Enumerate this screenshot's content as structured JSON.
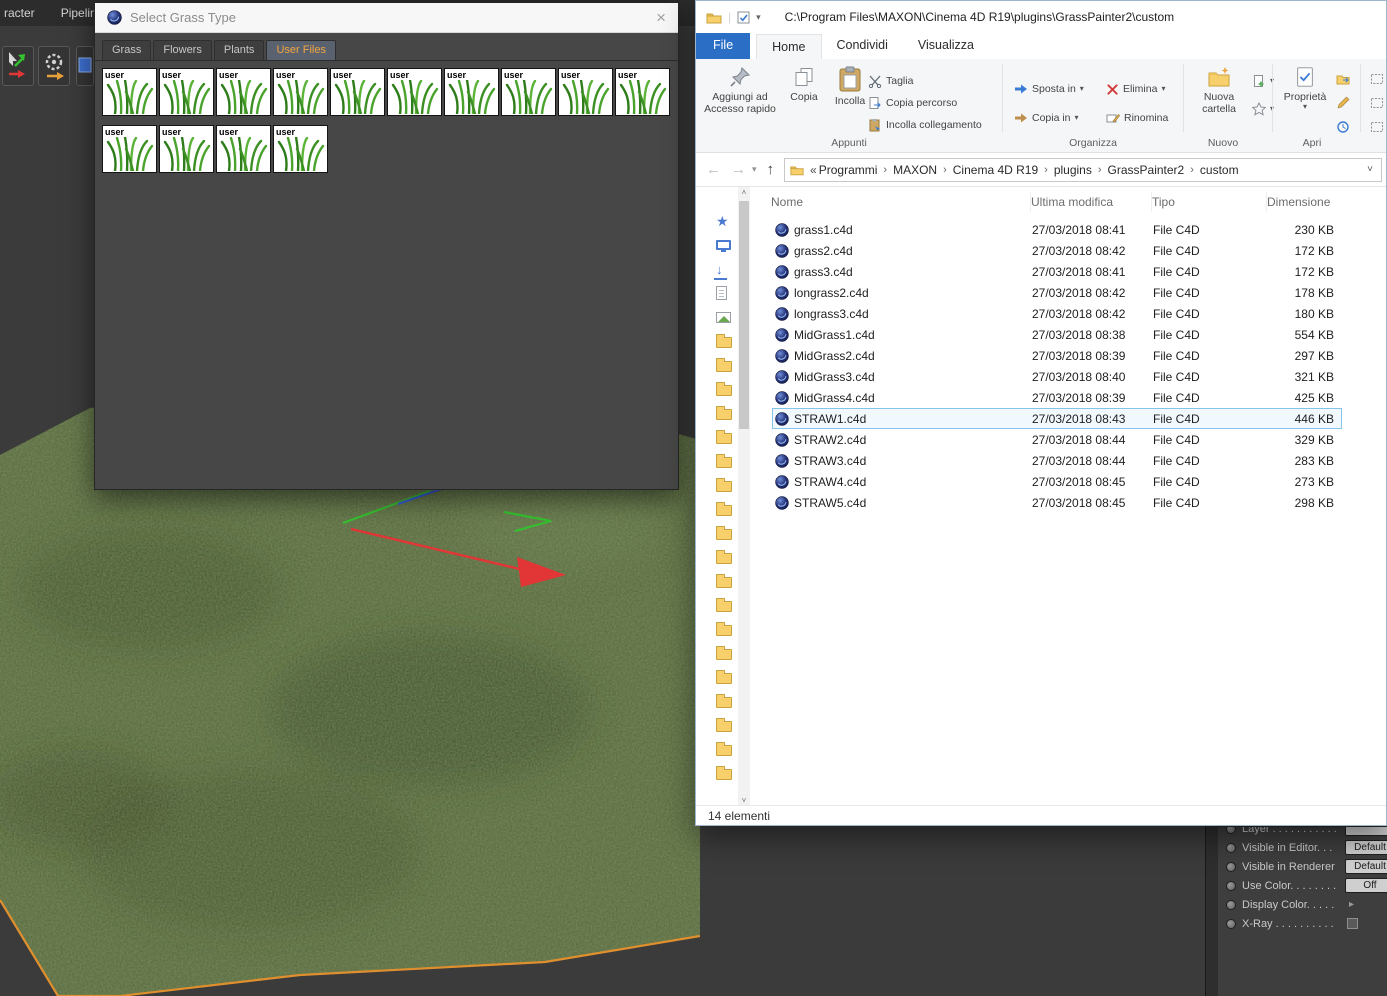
{
  "ui": {
    "dropdown": "▾",
    "breadcrumb_sep": "›",
    "back": "←",
    "forward": "→",
    "up": "↑",
    "address_chevron": "˅",
    "close": "×",
    "scroll_up": "˄",
    "scroll_down": "˅",
    "attr_arrow": "▸"
  },
  "colors": {
    "c4d_bg": "#3b3b3b",
    "menu_bg": "#2c2c2c",
    "dialog_bg": "#474747",
    "tab_active_text": "#f2a640",
    "file_tab": "#2b6ec6",
    "sel_border": "#84c3ea",
    "folder": "#f7d06b",
    "outline_orange": "#df8f2e",
    "axis_red": "#e23636",
    "axis_green": "#35c22f",
    "axis_blue": "#3b5bd7"
  },
  "c4d": {
    "menu": {
      "items": [
        {
          "label": "racter"
        },
        {
          "label": "Pipeline"
        }
      ]
    },
    "dialog": {
      "title": "Select Grass Type",
      "tabs": [
        {
          "label": "Grass"
        },
        {
          "label": "Flowers"
        },
        {
          "label": "Plants"
        },
        {
          "label": "User Files",
          "active": true
        }
      ],
      "thumbnails": [
        "user",
        "user",
        "user",
        "user",
        "user",
        "user",
        "user",
        "user",
        "user",
        "user",
        "user",
        "user",
        "user",
        "user"
      ]
    },
    "attributes": {
      "rows": [
        {
          "label": "Layer . . . . . . . . . . .",
          "control": "button",
          "value": ""
        },
        {
          "label": "Visible in Editor. . .",
          "control": "button",
          "value": "Default"
        },
        {
          "label": "Visible in Renderer",
          "control": "button",
          "value": "Default"
        },
        {
          "label": "Use Color. . . . . . . .",
          "control": "button",
          "value": "Off"
        },
        {
          "label": "Display Color. . . . .",
          "control": "arrow",
          "value": ""
        },
        {
          "label": "X-Ray . . . . . . . . . .",
          "control": "checkbox",
          "value": ""
        }
      ]
    }
  },
  "explorer": {
    "titlebar": {
      "path": "C:\\Program Files\\MAXON\\Cinema 4D R19\\plugins\\GrassPainter2\\custom"
    },
    "ribbon": {
      "tabs": [
        {
          "label": "File",
          "file": true
        },
        {
          "label": "Home",
          "active": true
        },
        {
          "label": "Condividi"
        },
        {
          "label": "Visualizza"
        }
      ],
      "clipboard": {
        "pin": "Aggiungi ad Accesso rapido",
        "copy": "Copia",
        "paste": "Incolla",
        "cut": "Taglia",
        "copy_path": "Copia percorso",
        "paste_shortcut": "Incolla collegamento",
        "group": "Appunti"
      },
      "organize": {
        "move": "Sposta in",
        "copy_to": "Copia in",
        "delete": "Elimina",
        "rename": "Rinomina",
        "group": "Organizza"
      },
      "new_group": {
        "new_folder": "Nuova cartella",
        "group": "Nuovo"
      },
      "open_group": {
        "properties": "Proprietà",
        "group": "Apri"
      }
    },
    "navbar": {
      "overflow": "«",
      "breadcrumb": [
        {
          "label": "Programmi"
        },
        {
          "label": "MAXON"
        },
        {
          "label": "Cinema 4D R19"
        },
        {
          "label": "plugins"
        },
        {
          "label": "GrassPainter2"
        },
        {
          "label": "custom"
        }
      ]
    },
    "sidebar": {
      "items": [
        "quick-access",
        "desktop",
        "download",
        "document",
        "pictures",
        "folder",
        "folder",
        "folder",
        "folder",
        "folder",
        "folder",
        "folder",
        "folder",
        "folder",
        "folder",
        "folder",
        "folder",
        "folder",
        "folder",
        "folder",
        "folder",
        "folder",
        "folder",
        "folder"
      ]
    },
    "list": {
      "columns": [
        {
          "label": "Nome"
        },
        {
          "label": "Ultima modifica"
        },
        {
          "label": "Tipo"
        },
        {
          "label": "Dimensione"
        }
      ],
      "files": [
        {
          "name": "grass1.c4d",
          "modified": "27/03/2018 08:41",
          "type": "File C4D",
          "size": "230 KB"
        },
        {
          "name": "grass2.c4d",
          "modified": "27/03/2018 08:42",
          "type": "File C4D",
          "size": "172 KB"
        },
        {
          "name": "grass3.c4d",
          "modified": "27/03/2018 08:41",
          "type": "File C4D",
          "size": "172 KB"
        },
        {
          "name": "longrass2.c4d",
          "modified": "27/03/2018 08:42",
          "type": "File C4D",
          "size": "178 KB"
        },
        {
          "name": "longrass3.c4d",
          "modified": "27/03/2018 08:42",
          "type": "File C4D",
          "size": "180 KB"
        },
        {
          "name": "MidGrass1.c4d",
          "modified": "27/03/2018 08:38",
          "type": "File C4D",
          "size": "554 KB"
        },
        {
          "name": "MidGrass2.c4d",
          "modified": "27/03/2018 08:39",
          "type": "File C4D",
          "size": "297 KB"
        },
        {
          "name": "MidGrass3.c4d",
          "modified": "27/03/2018 08:40",
          "type": "File C4D",
          "size": "321 KB"
        },
        {
          "name": "MidGrass4.c4d",
          "modified": "27/03/2018 08:39",
          "type": "File C4D",
          "size": "425 KB"
        },
        {
          "name": "STRAW1.c4d",
          "modified": "27/03/2018 08:43",
          "type": "File C4D",
          "size": "446 KB",
          "selected": true
        },
        {
          "name": "STRAW2.c4d",
          "modified": "27/03/2018 08:44",
          "type": "File C4D",
          "size": "329 KB"
        },
        {
          "name": "STRAW3.c4d",
          "modified": "27/03/2018 08:44",
          "type": "File C4D",
          "size": "283 KB"
        },
        {
          "name": "STRAW4.c4d",
          "modified": "27/03/2018 08:45",
          "type": "File C4D",
          "size": "273 KB"
        },
        {
          "name": "STRAW5.c4d",
          "modified": "27/03/2018 08:45",
          "type": "File C4D",
          "size": "298 KB"
        }
      ]
    },
    "statusbar": {
      "count": "14 elementi"
    }
  }
}
